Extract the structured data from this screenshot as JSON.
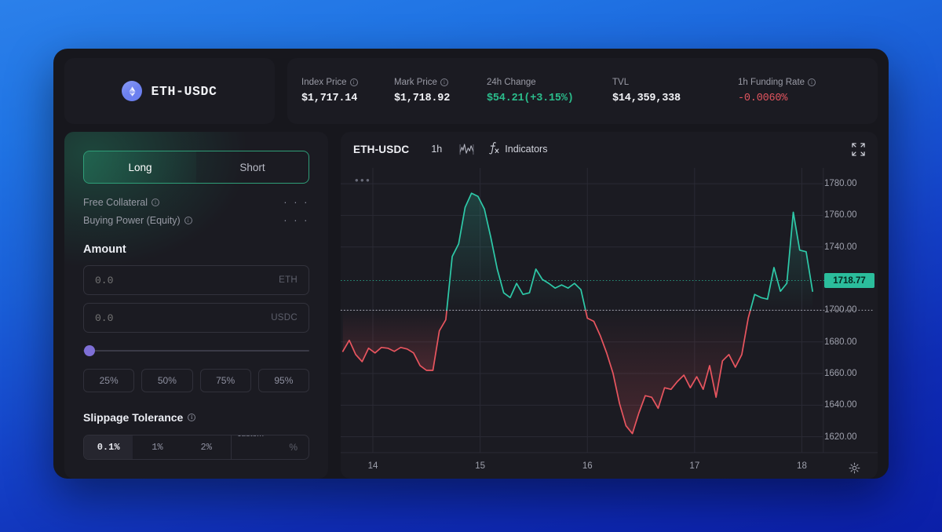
{
  "window": {
    "pair": {
      "logo_icon": "ethereum-logo-icon",
      "name": "ETH-USDC"
    },
    "stats": [
      {
        "label": "Index Price",
        "value": "$1,717.14",
        "info": true,
        "tone": "neutral"
      },
      {
        "label": "Mark Price",
        "value": "$1,718.92",
        "info": true,
        "tone": "neutral"
      },
      {
        "label": "24h Change",
        "value": "$54.21(+3.15%)",
        "info": false,
        "tone": "positive"
      },
      {
        "label": "TVL",
        "value": "$14,359,338",
        "info": false,
        "tone": "neutral"
      },
      {
        "label": "1h Funding Rate",
        "value": "-0.0060%",
        "info": true,
        "tone": "negative"
      }
    ]
  },
  "order_panel": {
    "side_toggle": {
      "long_label": "Long",
      "short_label": "Short",
      "selected": "Long"
    },
    "meta": [
      {
        "label": "Free Collateral",
        "value": "· · ·",
        "info": true
      },
      {
        "label": "Buying Power (Equity)",
        "value": "· · ·",
        "info": true
      }
    ],
    "amount": {
      "title": "Amount",
      "fields": [
        {
          "value": "0.0",
          "placeholder": "0.0",
          "unit": "ETH"
        },
        {
          "value": "0.0",
          "placeholder": "0.0",
          "unit": "USDC"
        }
      ],
      "slider_percent": 0,
      "quick_percents": [
        "25%",
        "50%",
        "75%",
        "95%"
      ]
    },
    "slippage": {
      "title": "Slippage Tolerance",
      "info": true,
      "options": [
        "0.1%",
        "1%",
        "2%"
      ],
      "selected": "0.1%",
      "custom_label": "custom",
      "custom_unit": "%",
      "custom_value": ""
    }
  },
  "chart_panel": {
    "symbol": "ETH-USDC",
    "timeframe": "1h",
    "chart_type_icon": "line-chart-icon",
    "indicators_icon": "fx-icon",
    "indicators_label": "Indicators",
    "expand_icon": "fullscreen-expand-icon",
    "menu_icon": "more-dots-icon",
    "settings_icon": "gear-icon",
    "current_price_tag": "1718.77"
  },
  "chart_data": {
    "type": "area",
    "title": "ETH-USDC",
    "xlabel": "",
    "ylabel": "",
    "ylim": [
      1610,
      1790
    ],
    "xlim": [
      13.7,
      18.2
    ],
    "grid": true,
    "legend": false,
    "x_ticks": [
      "14",
      "15",
      "16",
      "17",
      "18"
    ],
    "x_tick_values": [
      14,
      15,
      16,
      17,
      18
    ],
    "y_ticks": [
      "1780.00",
      "1760.00",
      "1740.00",
      "1700.00",
      "1680.00",
      "1660.00",
      "1640.00",
      "1620.00"
    ],
    "y_tick_values": [
      1780,
      1760,
      1740,
      1700,
      1680,
      1660,
      1640,
      1620
    ],
    "reference_lines": [
      {
        "label": "1718.77",
        "value": 1718.77,
        "color": "#2bbd9c",
        "style": "dotted"
      },
      {
        "label": "1700.00",
        "value": 1700.0,
        "color": "#cfd1db",
        "style": "dotted"
      }
    ],
    "colors": {
      "up": "#2ec9a8",
      "down": "#e8555f"
    },
    "threshold": 1700.0,
    "series": [
      {
        "name": "ETH-USDC price",
        "x": [
          13.72,
          13.78,
          13.84,
          13.9,
          13.96,
          14.02,
          14.08,
          14.14,
          14.2,
          14.26,
          14.32,
          14.38,
          14.44,
          14.5,
          14.56,
          14.62,
          14.68,
          14.74,
          14.8,
          14.86,
          14.92,
          14.98,
          15.04,
          15.1,
          15.16,
          15.22,
          15.28,
          15.34,
          15.4,
          15.46,
          15.52,
          15.58,
          15.64,
          15.7,
          15.76,
          15.82,
          15.88,
          15.94,
          16.0,
          16.06,
          16.12,
          16.18,
          16.24,
          16.3,
          16.36,
          16.42,
          16.48,
          16.54,
          16.6,
          16.66,
          16.72,
          16.78,
          16.84,
          16.9,
          16.96,
          17.02,
          17.08,
          17.14,
          17.2,
          17.26,
          17.32,
          17.38,
          17.44,
          17.5,
          17.56,
          17.62,
          17.68,
          17.74,
          17.8,
          17.86,
          17.92,
          17.98,
          18.04,
          18.1
        ],
        "values": [
          1674.0,
          1681.0,
          1672.0,
          1667.5,
          1676.0,
          1673.0,
          1676.5,
          1676.0,
          1674.0,
          1676.5,
          1675.5,
          1673.0,
          1665.0,
          1662.0,
          1662.0,
          1687.0,
          1694.0,
          1734.0,
          1742.0,
          1765.0,
          1774.0,
          1772.0,
          1764.0,
          1746.0,
          1726.0,
          1711.0,
          1708.0,
          1717.0,
          1710.0,
          1711.0,
          1726.0,
          1719.5,
          1717.0,
          1714.0,
          1716.0,
          1714.0,
          1717.0,
          1713.0,
          1695.0,
          1693.0,
          1684.0,
          1673.0,
          1660.0,
          1641.0,
          1627.0,
          1622.0,
          1635.0,
          1646.0,
          1645.0,
          1638.0,
          1651.0,
          1650.0,
          1655.0,
          1659.0,
          1651.0,
          1658.0,
          1650.0,
          1665.0,
          1645.0,
          1668.0,
          1672.0,
          1664.0,
          1672.0,
          1695.0,
          1710.0,
          1708.0,
          1707.0,
          1727.0,
          1712.0,
          1717.0,
          1762.0,
          1738.0,
          1737.0,
          1712.0
        ]
      }
    ]
  }
}
